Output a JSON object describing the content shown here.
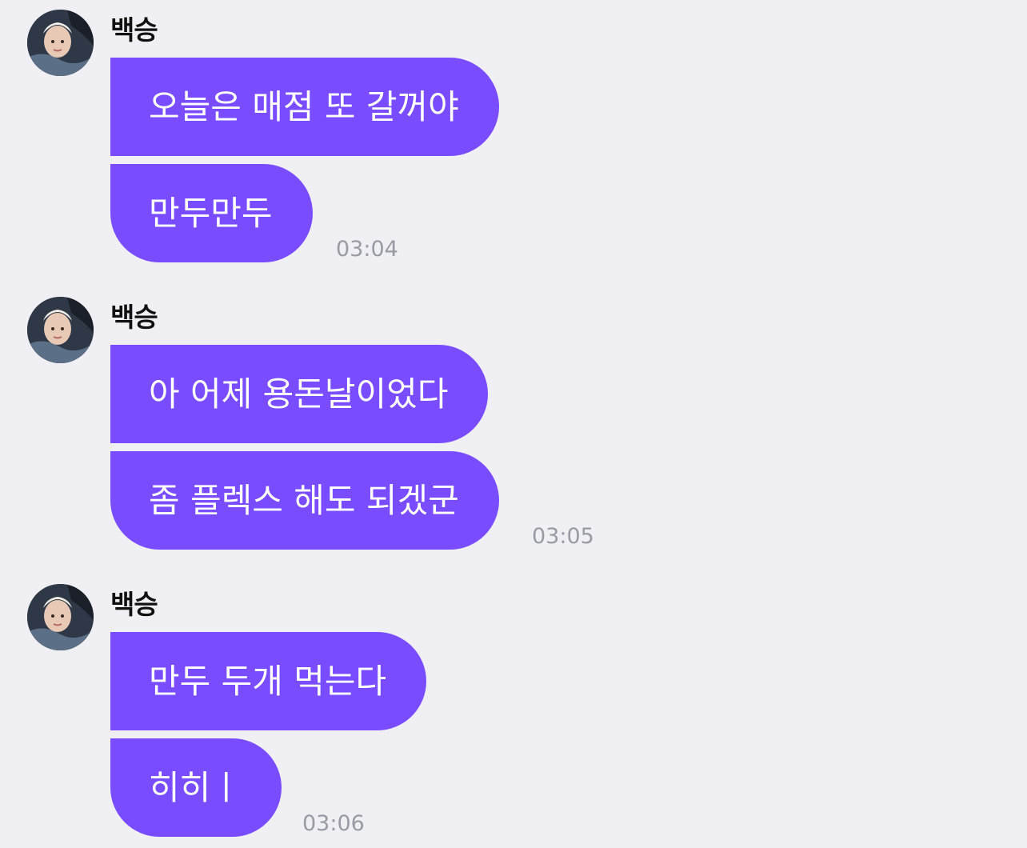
{
  "colors": {
    "background": "#efeff4",
    "bubble": "#7a4cff",
    "bubble_text": "#ffffff",
    "sender_text": "#111111",
    "timestamp_text": "#9a9aa2"
  },
  "groups": [
    {
      "sender": "백승",
      "avatar_icon": "profile-photo",
      "messages": [
        "오늘은 매점 또 갈꺼야",
        "만두만두"
      ],
      "time": "03:04"
    },
    {
      "sender": "백승",
      "avatar_icon": "profile-photo",
      "messages": [
        "아 어제 용돈날이었다",
        "좀 플렉스 해도 되겠군"
      ],
      "time": "03:05"
    },
    {
      "sender": "백승",
      "avatar_icon": "profile-photo",
      "messages": [
        "만두 두개 먹는다",
        "히히ㅣ"
      ],
      "time": "03:06"
    }
  ]
}
